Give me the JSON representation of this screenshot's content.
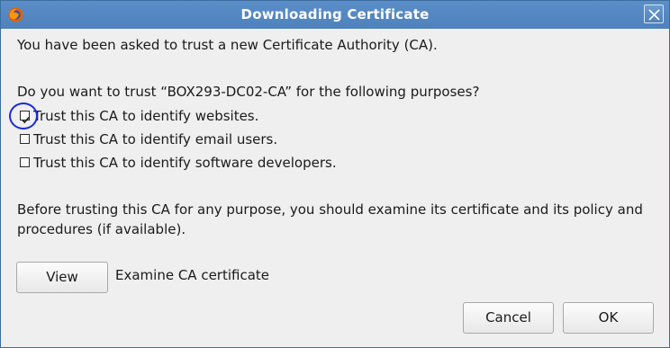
{
  "window": {
    "title": "Downloading Certificate",
    "icon": "firefox-icon",
    "close_icon": "close-icon"
  },
  "dialog": {
    "intro": "You have been asked to trust a new Certificate Authority (CA).",
    "question": "Do you want to trust “BOX293-DC02-CA” for the following purposes?",
    "options": [
      {
        "label": "Trust this CA to identify websites.",
        "checked": true
      },
      {
        "label": "Trust this CA to identify email users.",
        "checked": false
      },
      {
        "label": "Trust this CA to identify software developers.",
        "checked": false
      }
    ],
    "info": "Before trusting this CA for any purpose, you should examine its certificate and its policy and procedures (if available).",
    "view_label": "View",
    "view_desc": "Examine CA certificate",
    "cancel_label": "Cancel",
    "ok_label": "OK"
  },
  "colors": {
    "titlebar": "#4f82bd",
    "background": "#efefef",
    "highlight_ring": "#1a2cd6"
  }
}
